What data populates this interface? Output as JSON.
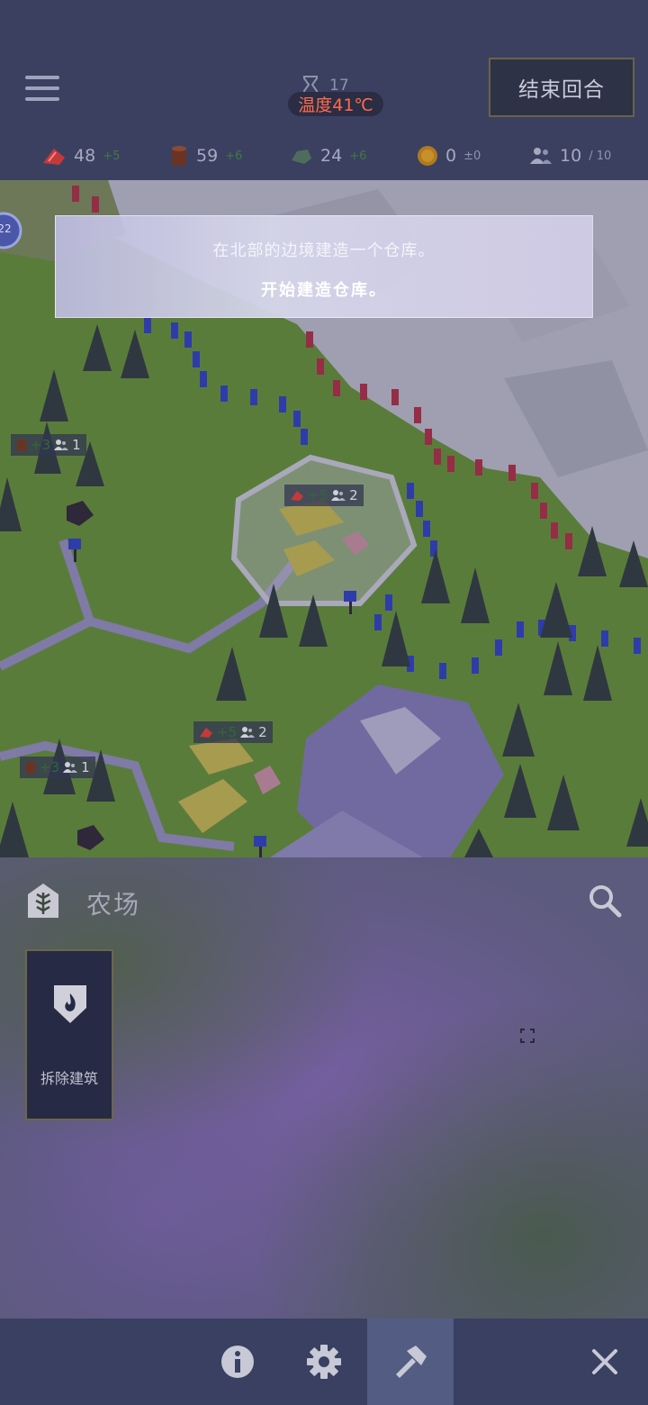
{
  "header": {
    "turn": "17",
    "temperature": "温度41℃",
    "end_turn_label": "结束回合"
  },
  "resources": [
    {
      "icon": "food-icon",
      "value": "48",
      "delta": "+5"
    },
    {
      "icon": "wood-icon",
      "value": "59",
      "delta": "+6"
    },
    {
      "icon": "stone-icon",
      "value": "24",
      "delta": "+6"
    },
    {
      "icon": "gold-coin-icon",
      "value": "0",
      "delta": "±0"
    },
    {
      "icon": "population-icon",
      "value": "10",
      "cap": "/ 10"
    }
  ],
  "map": {
    "tile_badge": "22",
    "badges": [
      {
        "icon": "wood-icon",
        "yield": "+3",
        "workers": "1"
      },
      {
        "icon": "food-icon",
        "yield": "+5",
        "workers": "2"
      },
      {
        "icon": "food-icon",
        "yield": "+5",
        "workers": "2"
      },
      {
        "icon": "wood-icon",
        "yield": "+3",
        "workers": "1"
      }
    ]
  },
  "tooltip": {
    "line1": "在北部的边境建造一个仓库。",
    "line2": "开始建造仓库。"
  },
  "panel": {
    "category_title": "农场",
    "cards": [
      {
        "label": "拆除建筑",
        "icon": "fire-shield-icon"
      }
    ]
  },
  "bottom_bar": {
    "items": [
      "info-icon",
      "gear-icon",
      "hammer-icon",
      "close-icon"
    ],
    "active": "hammer-icon"
  },
  "colors": {
    "temperature_red": "#ff6a4d",
    "border_red": "#c8283c",
    "border_blue": "#2a3fd6",
    "grass": "#6ea22b",
    "accent_gold": "#6d6649"
  }
}
